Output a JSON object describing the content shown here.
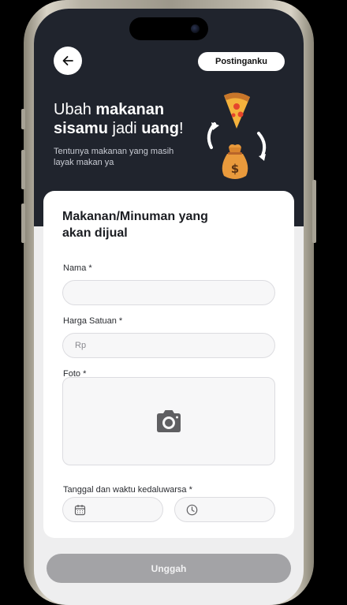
{
  "header": {
    "back_icon": "arrow-left-icon",
    "posting_label": "Postinganku"
  },
  "hero": {
    "headline_part1": "Ubah ",
    "headline_bold1": "makanan",
    "headline_bold2": "sisamu",
    "headline_part2": " jadi ",
    "headline_bold3": "uang",
    "headline_end": "!",
    "subtitle": "Tentunya makanan yang masih layak makan ya",
    "illustration": [
      "pizza-emoji",
      "money-bag-emoji",
      "cycle-arrows-icon"
    ]
  },
  "form": {
    "title": "Makanan/Minuman yang akan dijual",
    "name_label": "Nama *",
    "name_value": "",
    "price_label": "Harga Satuan *",
    "price_placeholder": "Rp",
    "photo_label": "Foto *",
    "photo_icon": "camera-icon",
    "expiry_label": "Tanggal dan waktu kedaluwarsa *",
    "date_icon": "calendar-icon",
    "time_icon": "clock-icon"
  },
  "footer": {
    "submit_label": "Unggah"
  },
  "colors": {
    "hero_bg": "#20242d",
    "page_bg": "#eeeeef",
    "button_disabled": "#a3a3a6"
  }
}
